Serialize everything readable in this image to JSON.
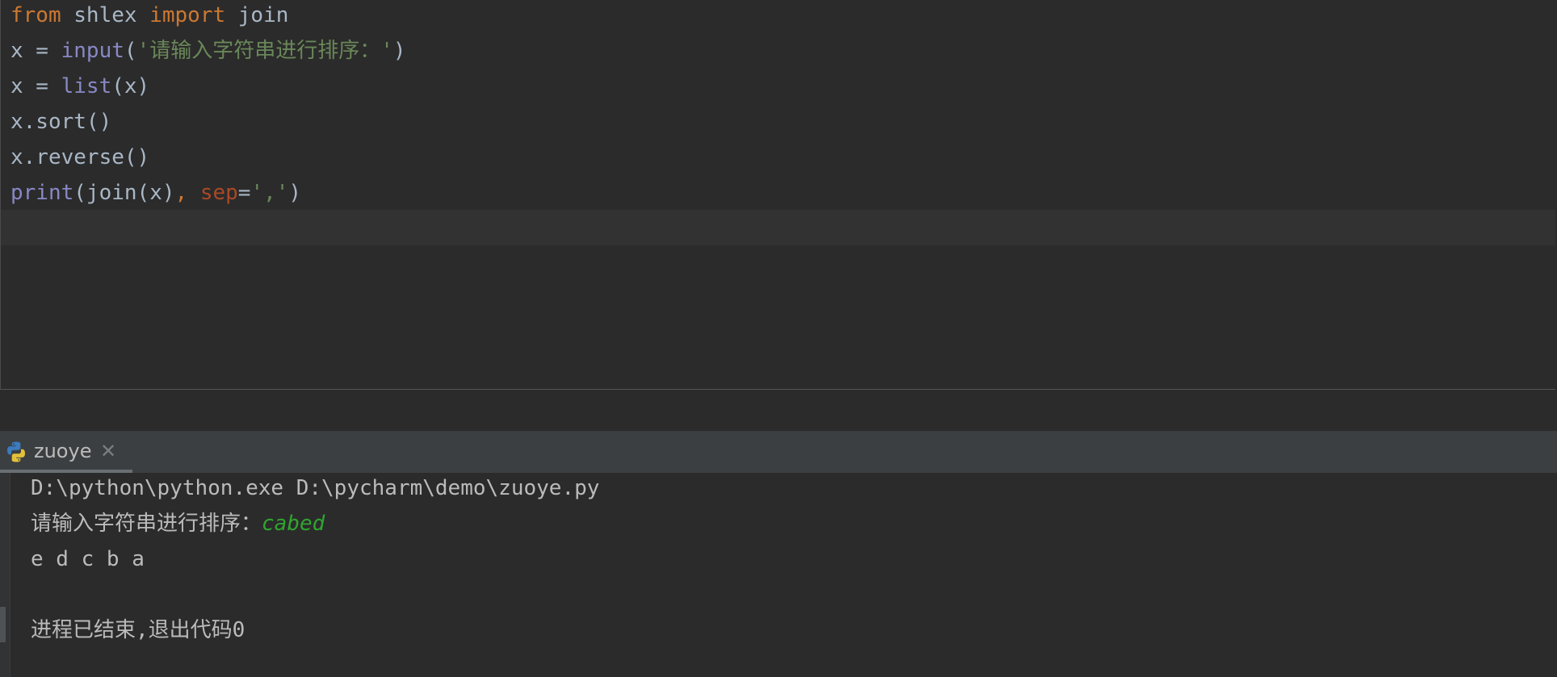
{
  "editor": {
    "lines": [
      [
        {
          "t": "from",
          "c": "kw"
        },
        {
          "t": " shlex ",
          "c": "plain"
        },
        {
          "t": "import",
          "c": "kw"
        },
        {
          "t": " join",
          "c": "plain"
        }
      ],
      [
        {
          "t": "x = ",
          "c": "plain"
        },
        {
          "t": "input",
          "c": "bi"
        },
        {
          "t": "(",
          "c": "plain"
        },
        {
          "t": "'请输入字符串进行排序：'",
          "c": "str"
        },
        {
          "t": ")",
          "c": "plain"
        }
      ],
      [
        {
          "t": "x = ",
          "c": "plain"
        },
        {
          "t": "list",
          "c": "bi"
        },
        {
          "t": "(x)",
          "c": "plain"
        }
      ],
      [
        {
          "t": "x.sort()",
          "c": "plain"
        }
      ],
      [
        {
          "t": "x.reverse()",
          "c": "plain"
        }
      ],
      [
        {
          "t": "print",
          "c": "bi"
        },
        {
          "t": "(join(x)",
          "c": "plain"
        },
        {
          "t": ", ",
          "c": "kw"
        },
        {
          "t": "sep",
          "c": "param"
        },
        {
          "t": "=",
          "c": "plain"
        },
        {
          "t": "','",
          "c": "str"
        },
        {
          "t": ")",
          "c": "plain"
        }
      ]
    ]
  },
  "run_tab": {
    "label": "zuoye",
    "close_glyph": "✕",
    "icon": "python-icon"
  },
  "console": {
    "command": "D:\\python\\python.exe D:\\pycharm\\demo\\zuoye.py",
    "prompt": "请输入字符串进行排序：",
    "user_input": "cabed",
    "output": "e d c b a",
    "exit_message": "进程已结束,退出代码0"
  },
  "colors": {
    "keyword": "#cc7832",
    "builtin": "#8888c6",
    "string": "#6a8759",
    "param": "#aa4926",
    "user_input": "#2fa52f"
  }
}
